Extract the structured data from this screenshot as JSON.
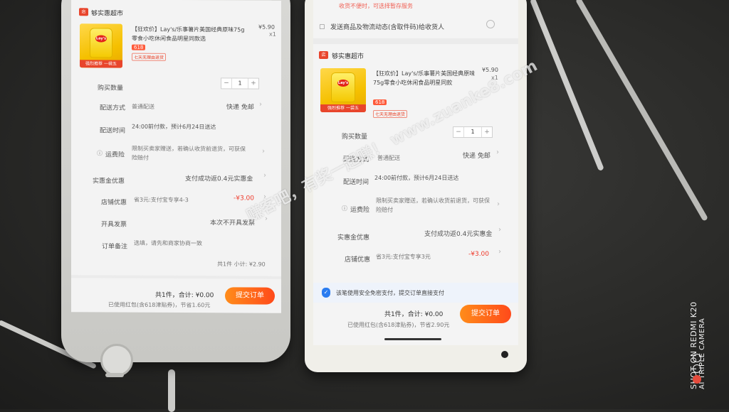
{
  "left": {
    "shop_name": "够实惠超市",
    "product_title": "【狂欢价】Lay's/乐事薯片美国经典原味75g零食小吃休闲食品明星同款选",
    "price": "¥5.90",
    "qty_x": "x1",
    "img_band": "强烈推荐 一袋五",
    "tag_618": "618",
    "tag_return": "七天无理由退货",
    "rows": {
      "qty_label": "购买数量",
      "qty_value": "1",
      "delivery_label": "配送方式",
      "delivery_mid": "普通配送",
      "delivery_value": "快递 免邮",
      "time_label": "配送时间",
      "time_value": "24:00前付款，预计6月24日送达",
      "insurance_label": "运费险",
      "insurance_value": "限制买卖家赠送，若确认收货前退货，可获保险赔付",
      "allowance_label": "实惠金优惠",
      "allowance_value": "支付成功返0.4元实惠金",
      "store_label": "店铺优惠",
      "store_mid": "省3元:支付宝专享4-3",
      "store_value": "-¥3.00",
      "invoice_label": "开具发票",
      "invoice_value": "本次不开具发票",
      "note_label": "订单备注",
      "note_value": "选填，请先和商家协商一致",
      "subtotal": "共1件 小计: ¥2.90"
    },
    "bottom": {
      "total": "共1件，合计: ¥0.00",
      "redpacket": "已使用红包(含618津贴券)，节省1.60元",
      "submit": "提交订单"
    }
  },
  "right": {
    "top_notice": "收货不便时，可选择暂存服务",
    "notify": "发送商品及物流动态(含取件码)给收货人",
    "shop_name": "够实惠超市",
    "product_title": "【狂欢价】Lay's/乐事薯片美国经典原味75g零食小吃休闲食品明星同款",
    "price": "¥5.90",
    "qty_x": "x1",
    "img_band": "强烈推荐 一袋五",
    "tag_618": "618",
    "tag_return": "七天无理由退货",
    "rows": {
      "qty_label": "购买数量",
      "qty_value": "1",
      "delivery_label": "配送方式",
      "delivery_mid": "普通配送",
      "delivery_value": "快递 免邮",
      "time_label": "配送时间",
      "time_value": "24:00前付款，预计6月24日送达",
      "insurance_label": "运费险",
      "insurance_value": "限制买卖家赠送，若确认收货前退货，可获保险赔付",
      "allowance_label": "实惠金优惠",
      "allowance_value": "支付成功返0.4元实惠金",
      "store_label": "店铺优惠",
      "store_mid": "省3元:支付宝专享3元",
      "store_value": "-¥3.00"
    },
    "security": "该笔使用安全免密支付，提交订单直接支付",
    "bottom": {
      "total": "共1件，合计: ¥0.00",
      "redpacket": "已使用红包(含618津贴券)，节省2.90元",
      "submit": "提交订单"
    }
  },
  "watermark": "赚客吧，有奖一起赚！ www.zuanke8.com",
  "camera": {
    "line1": "SHOT ON REDMI K20",
    "line2": "AI TRIPLE CAMERA"
  }
}
